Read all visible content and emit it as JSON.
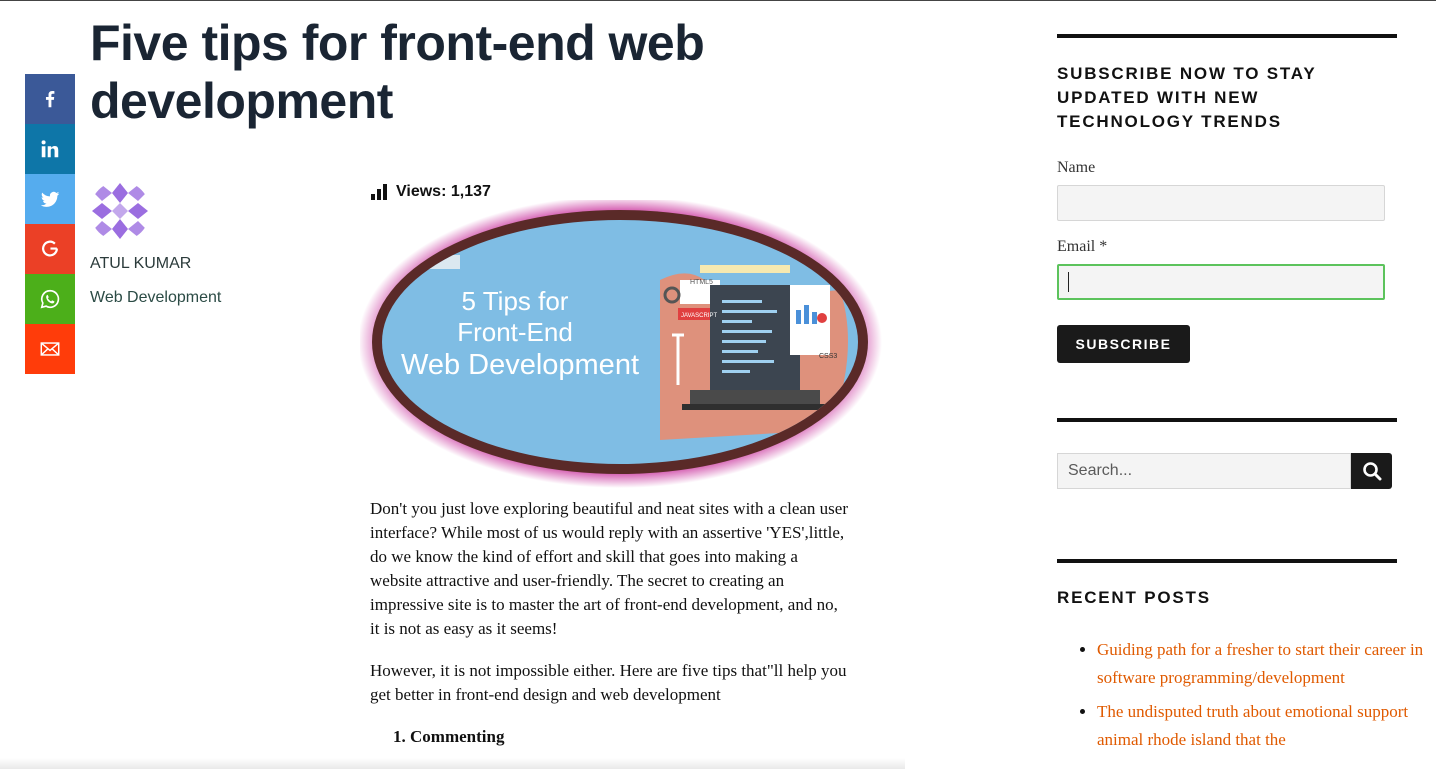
{
  "post": {
    "title": "Five tips for front-end web development",
    "author": "ATUL KUMAR",
    "category": "Web Development",
    "views_label": "Views: 1,137",
    "hero": {
      "line1": "5 Tips for",
      "line2": "Front-End",
      "line3": "Web Development",
      "tags": [
        "HTML5",
        "JAVASCRIPT",
        "CSS3"
      ]
    },
    "paragraphs": [
      "Don't you just love exploring beautiful and neat sites with a clean user interface? While most of us would reply with an assertive 'YES',little, do we know the kind of effort and skill that goes into making a website attractive and user-friendly. The secret to creating an impressive site is to master the art of front-end development, and no, it is not as easy as it seems!",
      "However, it is not impossible either. Here are five tips that\"ll help you get better in front-end design and web development"
    ],
    "list": [
      "Commenting"
    ]
  },
  "share": [
    {
      "icon": "facebook-icon",
      "color": "#3b5998"
    },
    {
      "icon": "linkedin-icon",
      "color": "#0e76a8"
    },
    {
      "icon": "twitter-icon",
      "color": "#55acee"
    },
    {
      "icon": "google-icon",
      "color": "#eb4026"
    },
    {
      "icon": "whatsapp-icon",
      "color": "#4caf1a"
    },
    {
      "icon": "email-icon",
      "color": "#ff3c0a"
    }
  ],
  "sidebar": {
    "subscribe": {
      "title": "SUBSCRIBE NOW TO STAY UPDATED WITH NEW TECHNOLOGY TRENDS",
      "name_label": "Name",
      "email_label": "Email *",
      "name_value": "",
      "email_value": "",
      "button": "SUBSCRIBE",
      "focus_color": "#5cc35c"
    },
    "search": {
      "placeholder": "Search..."
    },
    "recent": {
      "title": "RECENT POSTS",
      "items": [
        "Guiding path for a fresher to start their career in software programming/development",
        "The undisputed truth about emotional support animal rhode island that the"
      ],
      "link_color": "#e05a00"
    }
  }
}
